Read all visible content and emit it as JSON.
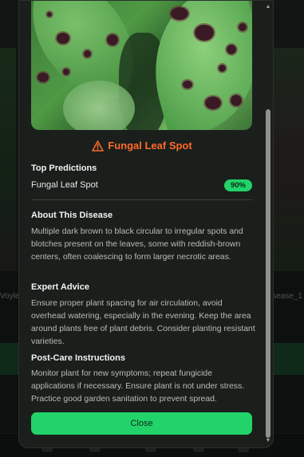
{
  "background": {
    "caption_left": "Voyle",
    "caption_right": "isease_1"
  },
  "modal": {
    "diagnosis": {
      "title": "Fungal Leaf Spot",
      "icon": "warning-triangle-icon",
      "color": "#ff6a2a"
    },
    "top_predictions": {
      "heading": "Top Predictions",
      "items": [
        {
          "label": "Fungal Leaf Spot",
          "confidence": "90%"
        }
      ]
    },
    "about": {
      "heading": "About This Disease",
      "text": "Multiple dark brown to black circular to irregular spots and blotches present on the leaves, some with reddish-brown centers, often coalescing to form larger necrotic areas."
    },
    "expert_advice": {
      "heading": "Expert Advice",
      "text": "Ensure proper plant spacing for air circulation, avoid overhead watering, especially in the evening. Keep the area around plants free of plant debris. Consider planting resistant varieties."
    },
    "post_care": {
      "heading": "Post-Care Instructions",
      "text": "Monitor plant for new symptoms; repeat fungicide applications if necessary. Ensure plant is not under stress. Practice good garden sanitation to prevent spread."
    },
    "close_label": "Close",
    "accent": "#22d36a"
  }
}
